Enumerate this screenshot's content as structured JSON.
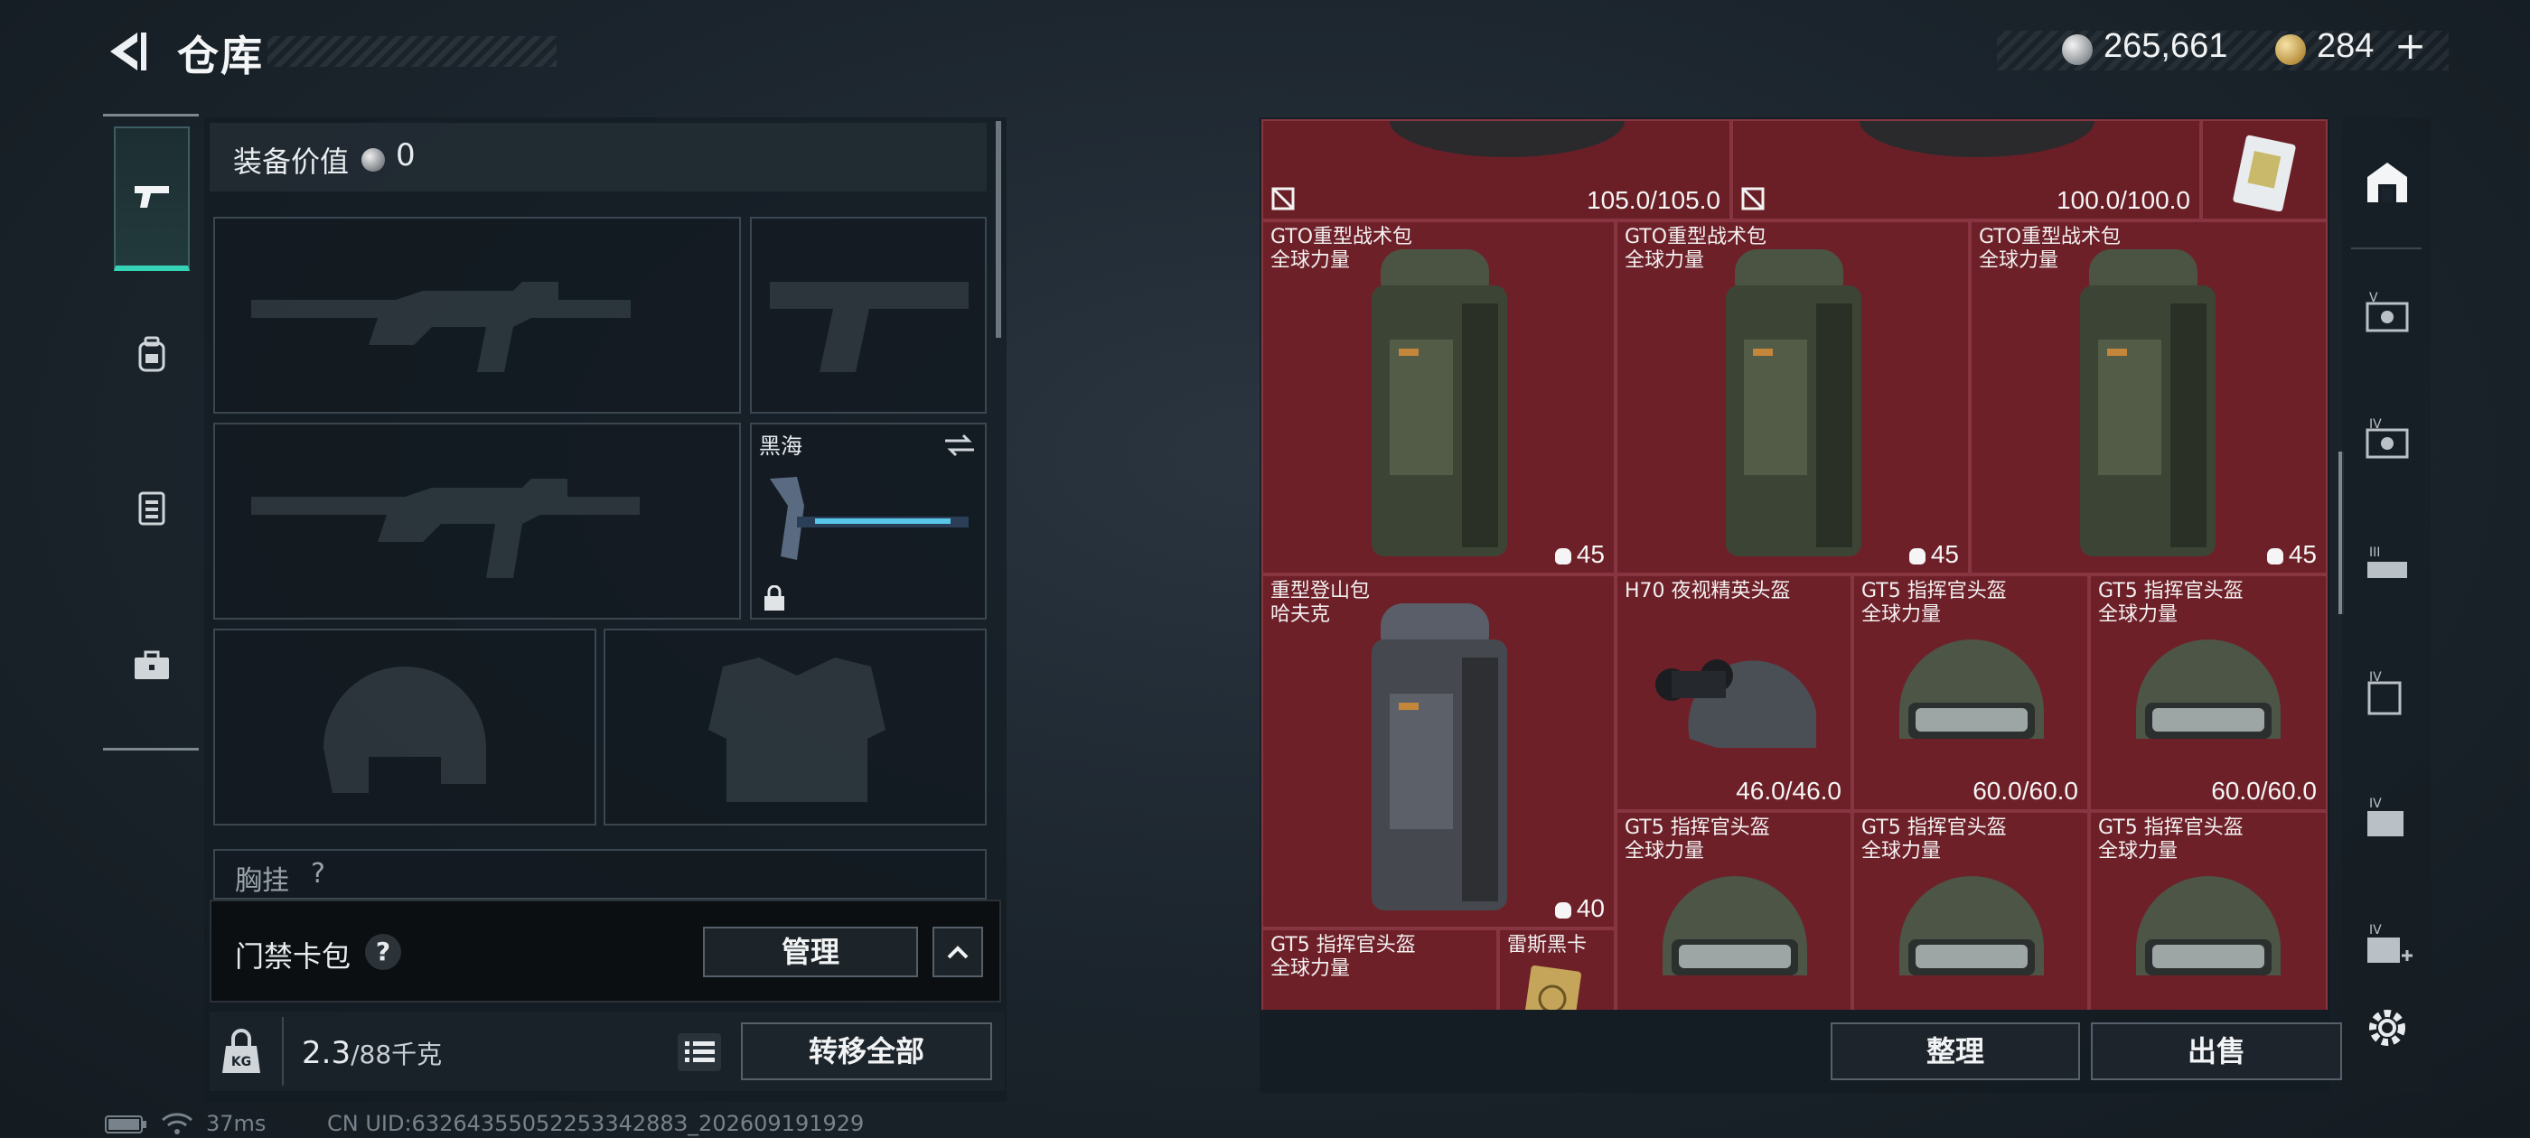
{
  "header": {
    "title": "仓库",
    "currency_silver": "265,661",
    "currency_gold": "284",
    "plus": "+"
  },
  "equipment": {
    "value_label": "装备价值",
    "value": "0",
    "melee_name": "黑海",
    "chest_label": "胸挂",
    "chest_extra": "?"
  },
  "card_pack": {
    "label": "门禁卡包",
    "help": "?",
    "manage_button": "管理"
  },
  "footer_left": {
    "weight_value": "2.3",
    "weight_max": "/88千克",
    "transfer_all_button": "转移全部"
  },
  "inventory": {
    "top_row": [
      {
        "durability": "105.0/105.0"
      },
      {
        "durability": "100.0/100.0"
      }
    ],
    "items": [
      {
        "name": "GTO重型战术包",
        "sub": "全球力量",
        "capacity": "45"
      },
      {
        "name": "GTO重型战术包",
        "sub": "全球力量",
        "capacity": "45"
      },
      {
        "name": "GTO重型战术包",
        "sub": "全球力量",
        "capacity": "45"
      },
      {
        "name": "重型登山包",
        "sub": "哈夫克",
        "capacity": "40"
      },
      {
        "name": "H70 夜视精英头盔",
        "sub": "",
        "durability": "46.0/46.0"
      },
      {
        "name": "GT5 指挥官头盔",
        "sub": "全球力量",
        "durability": "60.0/60.0"
      },
      {
        "name": "GT5 指挥官头盔",
        "sub": "全球力量",
        "durability": "60.0/60.0"
      },
      {
        "name": "GT5 指挥官头盔",
        "sub": "全球力量"
      },
      {
        "name": "GT5 指挥官头盔",
        "sub": "全球力量"
      },
      {
        "name": "GT5 指挥官头盔",
        "sub": "全球力量"
      },
      {
        "name": "GT5 指挥官头盔",
        "sub": "全球力量"
      },
      {
        "name": "雷斯黑卡",
        "sub": ""
      }
    ],
    "sort_button": "整理",
    "sell_button": "出售"
  },
  "status_bar": {
    "ping": "37ms",
    "uid": "CN UID:6326435505225334288З_202609191929"
  }
}
